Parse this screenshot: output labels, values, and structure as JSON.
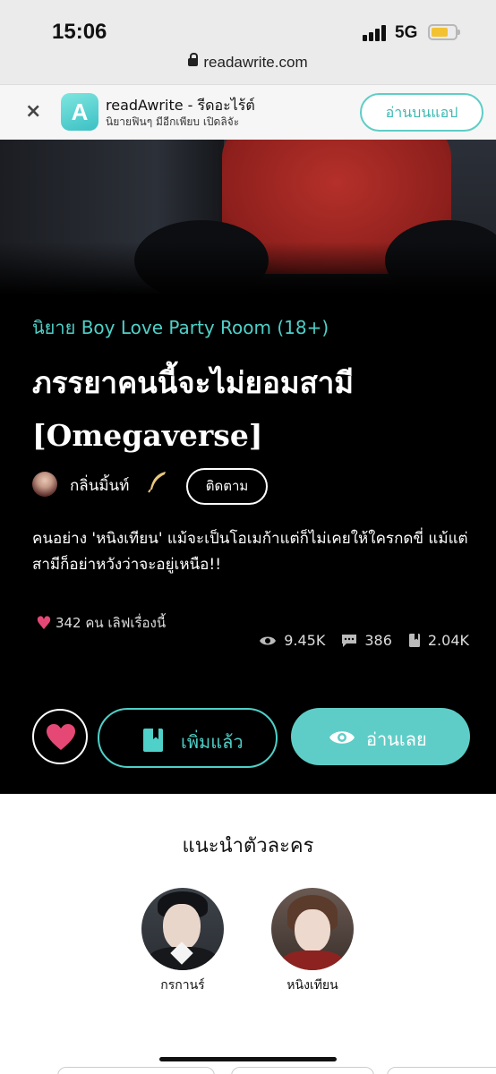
{
  "status_bar": {
    "time": "15:06",
    "network": "5G"
  },
  "browser": {
    "url": "readawrite.com"
  },
  "app_banner": {
    "close_label": "×",
    "app_icon_letter": "A",
    "title": "readAwrite - รีดอะไร้ต์",
    "subtitle": "นิยายฟินๆ มีอีกเพียบ เปิดลิจัะ",
    "open_button": "อ่านบนแอป"
  },
  "novel": {
    "category_prefix": "นิยาย",
    "category": "Boy Love Party Room (18+)",
    "title": "ภรรยาคนนี้จะไม่ยอมสามี [Omegaverse]",
    "author": "กลิ่นมิ้นท์",
    "follow_label": "ติดตาม",
    "description": "คนอย่าง 'หนิงเทียน' แม้จะเป็นโอเมก้าแต่ก็ไม่เคยให้ใครกดขี่ แม้แต่สามีก็อย่าหวังว่าจะอยู่เหนือ!!",
    "likes_text": "342 คน เลิฟเรื่องนี้",
    "stats": {
      "views": "9.45K",
      "comments": "386",
      "bookmarks": "2.04K"
    },
    "added_label": "เพิ่มแล้ว",
    "read_label": "อ่านเลย"
  },
  "characters": {
    "heading": "แนะนำตัวละคร",
    "items": [
      {
        "name": "กรกานร์"
      },
      {
        "name": "หนิงเทียน"
      }
    ]
  },
  "colors": {
    "accent": "#5fcdc7",
    "heart": "#e64875",
    "dark_bg": "#000000"
  }
}
